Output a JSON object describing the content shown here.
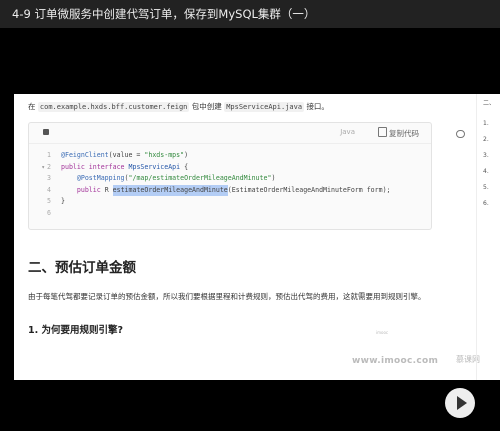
{
  "window": {
    "title": "4-9 订单微服务中创建代驾订单，保存到MySQL集群（一）"
  },
  "doc": {
    "intro_prefix": "在",
    "intro_package": "com.example.hxds.bff.customer.feign",
    "intro_mid": "包中创建",
    "intro_file": "MpsServiceApi.java",
    "intro_suffix": "接口。",
    "code_lang": "Java",
    "copy_label": "复制代码",
    "code": {
      "l1": "1",
      "l2": "2",
      "l3": "3",
      "l4": "4",
      "l5": "5",
      "l6": "6",
      "line1_annot": "@FeignClient",
      "line1_arg": "(value = ",
      "line1_str": "\"hxds-mps\"",
      "line1_end": ")",
      "line2_kw": "public interface",
      "line2_name": "MpsServiceApi",
      "line2_end": " {",
      "line3_annot": "@PostMapping",
      "line3_open": "(",
      "line3_str": "\"/map/estimateOrderMileageAndMinute\"",
      "line3_end": ")",
      "line4_kw": "public",
      "line4_type": " R ",
      "line4_method": "estimateOrderMileageAndMinute",
      "line4_args": "(EstimateOrderMileageAndMinuteForm form);",
      "line5": "}"
    },
    "heading2": "二、预估订单金额",
    "paragraph": "由于每笔代驾都要记录订单的预估金额，所以我们要根据里程和计费规则，预估出代驾的费用，这就需要用到规则引擎。",
    "heading3": "1. 为何要用规则引擎?",
    "watermark_small": "imooc",
    "watermark": "www.imooc.com",
    "logo_watermark": "慕课网"
  },
  "toc": {
    "items": [
      "二、",
      "1.",
      "2.",
      "3.",
      "4.",
      "5.",
      "6."
    ]
  }
}
